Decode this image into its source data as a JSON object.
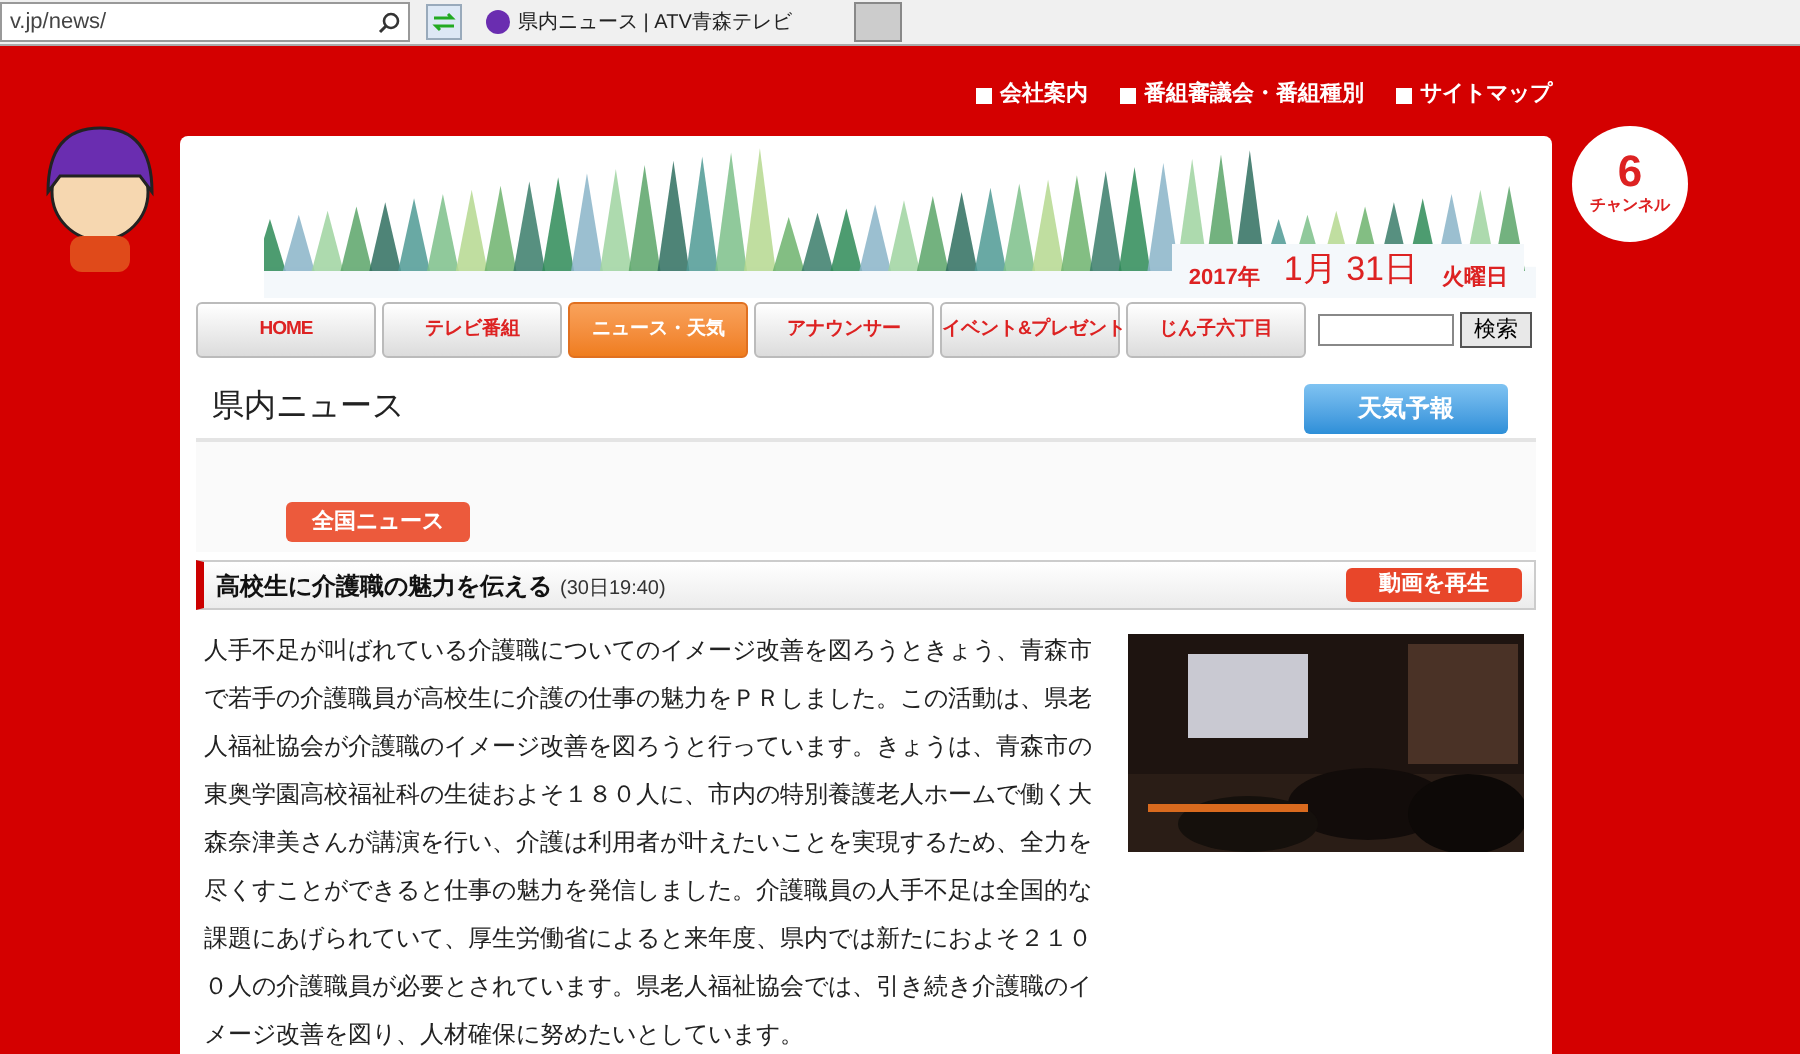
{
  "browser": {
    "address": "v.jp/news/",
    "tab_title": "県内ニュース | ATV青森テレビ"
  },
  "top_links": [
    "会社案内",
    "番組審議会・番組種別",
    "サイトマップ"
  ],
  "logo": {
    "number": "6",
    "label": "チャンネル"
  },
  "date": {
    "year": "2017年",
    "day": "1月 31日",
    "weekday": "火曜日"
  },
  "nav": [
    {
      "label": "HOME",
      "selected": false
    },
    {
      "label": "テレビ番組",
      "selected": false
    },
    {
      "label": "ニュース・天気",
      "selected": true
    },
    {
      "label": "アナウンサー",
      "selected": false
    },
    {
      "label": "イベント&プレゼント",
      "selected": false
    },
    {
      "label": "じん子六丁目",
      "selected": false
    }
  ],
  "search": {
    "button": "検索"
  },
  "section": {
    "title": "県内ニュース",
    "weather_button": "天気予報",
    "national_button": "全国ニュース"
  },
  "article": {
    "title": "高校生に介護職の魅力を伝える",
    "time": "(30日19:40)",
    "video_button": "動画を再生",
    "body": "人手不足が叫ばれている介護職についてのイメージ改善を図ろうときょう、青森市で若手の介護職員が高校生に介護の仕事の魅力をＰＲしました。この活動は、県老人福祉協会が介護職のイメージ改善を図ろうと行っています。きょうは、青森市の東奥学園高校福祉科の生徒およそ１８０人に、市内の特別養護老人ホームで働く大森奈津美さんが講演を行い、介護は利用者が叶えたいことを実現するため、全力を尽くすことができると仕事の魅力を発信しました。介護職員の人手不足は全国的な課題にあげられていて、厚生労働省によると来年度、県内では新たにおよそ２１００人の介護職員が必要とされています。県老人福祉協会では、引き続き介護職のイメージ改善を図り、人材確保に努めたいとしています。"
  }
}
